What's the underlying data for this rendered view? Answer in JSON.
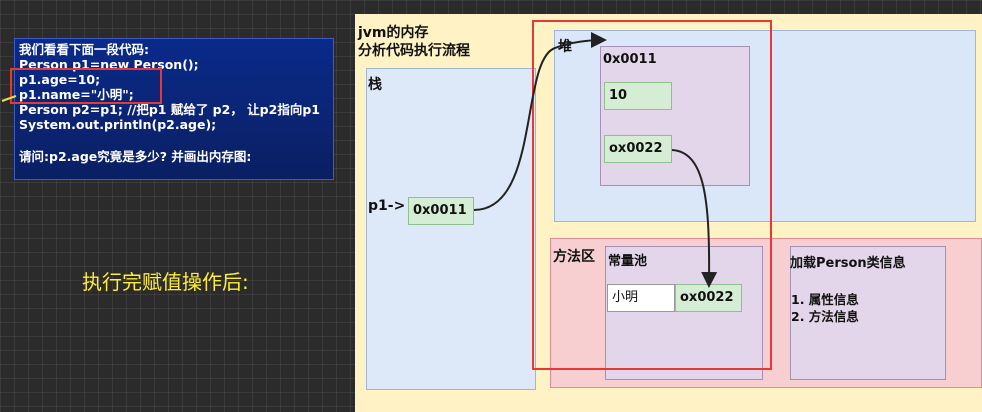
{
  "code_panel": {
    "lines": [
      "我们看看下面一段代码:",
      "Person p1=new Person();",
      "p1.age=10;",
      "p1.name=\"小明\";",
      "Person p2=p1; //把p1 赋给了 p2， 让p2指向p1",
      "System.out.println(p2.age);",
      "请问:p2.age究竟是多少? 并画出内存图:"
    ]
  },
  "caption": "执行完赋值操作后:",
  "diagram": {
    "title_line1": "jvm的内存",
    "title_line2": "分析代码执行流程",
    "stack": {
      "label": "栈",
      "var_label": "p1->",
      "var_value": "0x0011"
    },
    "heap": {
      "label": "堆",
      "object_address": "0x0011",
      "age_value": "10",
      "name_ref": "ox0022"
    },
    "method_area": {
      "label": "方法区",
      "constant_pool": {
        "label": "常量池",
        "string_value": "小明",
        "string_address": "ox0022"
      },
      "class_info": {
        "title": "加载Person类信息",
        "items": [
          "1. 属性信息",
          "2. 方法信息"
        ]
      }
    }
  },
  "colors": {
    "highlight": "#e53935",
    "caption": "#ffee33",
    "code_bg": "#0b2472",
    "diagram_bg": "#fff3c6",
    "arrow": "#222222"
  }
}
